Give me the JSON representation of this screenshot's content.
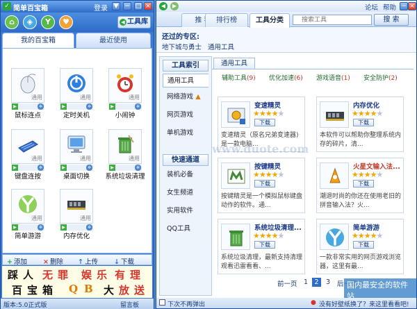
{
  "left": {
    "title": "简单百宝箱",
    "login": "登录",
    "toolbar": {
      "tool_lib": "工具库"
    },
    "tabs": [
      {
        "label": "我的百宝箱"
      },
      {
        "label": "最近使用"
      }
    ],
    "tools": [
      {
        "name": "鼠标连点",
        "tag": "通用",
        "icon": "mouse-icon"
      },
      {
        "name": "定时关机",
        "tag": "通用",
        "icon": "power-icon"
      },
      {
        "name": "小闹钟",
        "tag": "通用",
        "icon": "alarm-clock-icon"
      },
      {
        "name": "键盘连按",
        "tag": "通用",
        "icon": "keyboard-icon"
      },
      {
        "name": "桌面切换",
        "tag": "通用",
        "icon": "monitor-icon"
      },
      {
        "name": "系统垃圾清理",
        "tag": "通用",
        "icon": "trash-bin-icon"
      },
      {
        "name": "简单游游",
        "tag": "通用",
        "icon": "y-logo-icon"
      },
      {
        "name": "内存优化",
        "tag": "通用",
        "icon": "memory-chip-icon"
      }
    ],
    "actions": {
      "add": "添加",
      "delete": "删除",
      "up": "上传",
      "download": "下载"
    },
    "banner": {
      "chars1": [
        "踩",
        "人",
        "无",
        "罪",
        "娱",
        "乐",
        "有",
        "理"
      ],
      "chars2": [
        "百",
        "宝",
        "箱",
        "Q",
        "B",
        "大",
        "放",
        "送"
      ]
    },
    "status": {
      "version": "版本:5.0正式版",
      "board": "留言板"
    }
  },
  "right": {
    "top_links": {
      "forum": "论坛",
      "help": "帮助"
    },
    "tabs": [
      {
        "label": "推 荐"
      },
      {
        "label": "排行榜"
      },
      {
        "label": "工具分类"
      }
    ],
    "search": {
      "placeholder": "搜索工具",
      "button": "搜 索"
    },
    "visited": {
      "label": "还过的专区:",
      "items": [
        "地下城与勇士",
        "通用工具"
      ]
    },
    "index": {
      "head1": "工具索引",
      "items1": [
        "通用工具",
        "网络游戏",
        "网页游戏",
        "单机游戏"
      ],
      "head2": "快速通道",
      "items2": [
        "装机必备",
        "女生频道",
        "实用软件",
        "QQ工具"
      ]
    },
    "sub_tab": "通用工具",
    "subcats": [
      {
        "label": "辅助工具",
        "count": "(9)"
      },
      {
        "label": "优化加速",
        "count": "(6)"
      },
      {
        "label": "游戏语音",
        "count": "(1)"
      },
      {
        "label": "安全防护",
        "count": "(2)"
      }
    ],
    "cards": [
      {
        "name": "变速精灵",
        "stars": 4,
        "dl": "下载",
        "desc": "变速精灵（原名兄弟变速器)是一款电脑...",
        "icon": "speed-gear-icon"
      },
      {
        "name": "内存优化",
        "stars": 4,
        "dl": "下载",
        "desc": "本软件可以帮助你整理系统内存的碎片，清...",
        "icon": "memory-chip-icon"
      },
      {
        "name": "按键精灵",
        "stars": 4,
        "dl": "下载",
        "desc": "按键精灵是一个模拟鼠标键盘动作的软件。通...",
        "icon": "key-sprite-icon"
      },
      {
        "name": "火星文输入法...",
        "stars": 4,
        "dl": "下载",
        "desc": "潮退时尚的你还在使用老旧的拼音输入法？火...",
        "icon": "mars-input-icon"
      },
      {
        "name": "系统垃圾清理...",
        "stars": 4,
        "dl": "下载",
        "desc": "系统垃圾清理，最新支持清理观看迅雷看看、...",
        "icon": "trash-bin-icon"
      },
      {
        "name": "简单游游",
        "stars": 4,
        "dl": "下载",
        "desc": "一款非常实用的网页游戏浏览器，这里有最...",
        "icon": "y-logo-icon"
      }
    ],
    "pager": {
      "prev": "前一页",
      "pages": [
        "1",
        "2",
        "3"
      ],
      "current": "2",
      "next": "后一页"
    },
    "status": {
      "popup": "下次不再弹出",
      "tip": "没有好壁纸换了？来这里看看吧!"
    }
  },
  "watermarks": {
    "center": "www.duote.com",
    "corner": "国内最安全的软件站"
  }
}
